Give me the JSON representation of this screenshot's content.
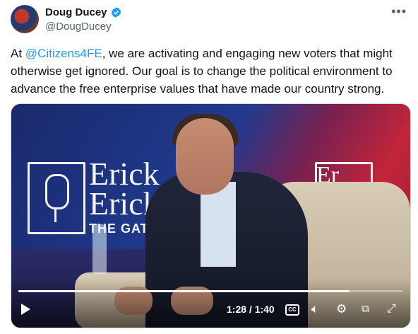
{
  "author": {
    "display_name": "Doug Ducey",
    "handle": "@DougDucey",
    "verified_icon": "verified-badge-icon"
  },
  "more_icon": "more-options-icon",
  "tweet": {
    "prefix": "At ",
    "mention": "@Citizens4FE",
    "body": ", we are activating and engaging new voters that might otherwise get ignored. Our goal is to change the political environment to advance the free enterprise values that have made our country strong."
  },
  "video": {
    "backdrop_brand_lines": [
      "Erick",
      "Ericks"
    ],
    "backdrop_tagline": "THE GATH",
    "backdrop_brand_right": "Er",
    "progress": 0.86,
    "time": "1:28 / 1:40",
    "cc_label": "CC",
    "icons": [
      "play-icon",
      "captions-icon",
      "volume-icon",
      "settings-gear-icon",
      "picture-in-picture-icon",
      "fullscreen-icon"
    ]
  },
  "colors": {
    "link": "#1d9bf0",
    "verified": "#1d9bf0",
    "muted_text": "#536471"
  }
}
